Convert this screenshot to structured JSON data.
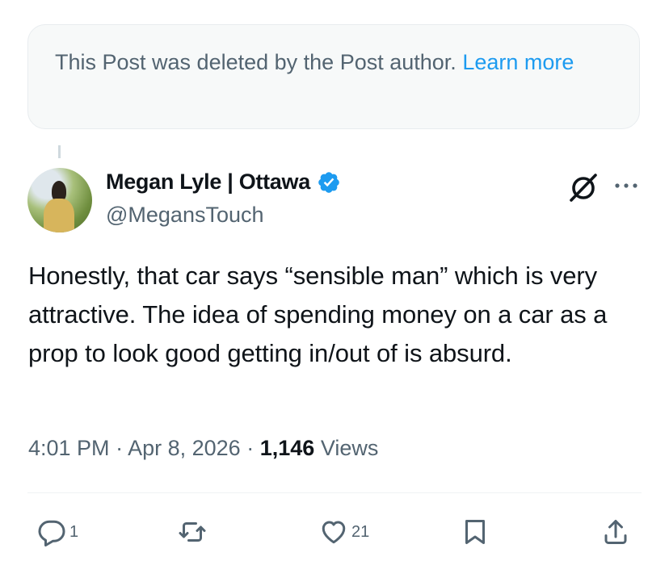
{
  "deleted_notice": {
    "text": "This Post was deleted by the Post author.",
    "link_label": "Learn more"
  },
  "author": {
    "name": "Megan Lyle | Ottawa",
    "handle": "@MegansTouch",
    "verified_color": "#1d9bf0"
  },
  "post": {
    "text": "Honestly, that car says “sensible man” which is very attractive. The idea of spending money on a car as a prop to look good getting in/out of is absurd.",
    "time": "4:01 PM",
    "separator": "·",
    "date": "Apr 8, 2026",
    "views_count": "1,146",
    "views_label": "Views"
  },
  "actions": {
    "reply_count": "1",
    "like_count": "21"
  },
  "icons": [
    "grok-icon",
    "more-icon",
    "reply-icon",
    "repost-icon",
    "like-icon",
    "bookmark-icon",
    "share-icon",
    "verified-badge-icon"
  ],
  "colors": {
    "accent": "#1d9bf0",
    "text": "#0f1419",
    "secondary": "#536471"
  }
}
